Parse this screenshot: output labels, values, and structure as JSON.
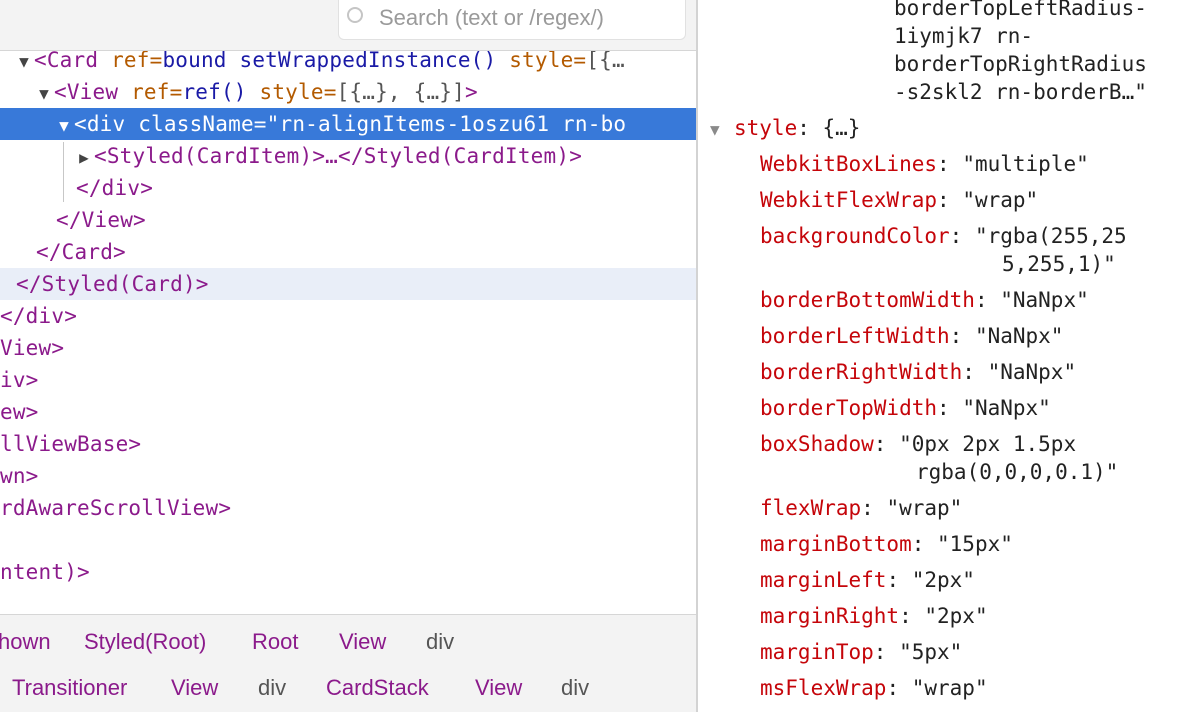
{
  "search": {
    "placeholder": "Search (text or /regex/)"
  },
  "tree": {
    "r0": {
      "open": "<",
      "name": "Card",
      "a1": "ref=",
      "v1": "bound setWrappedInstance()",
      "a2": "style=",
      "v2": "[{…"
    },
    "r1": {
      "open": "<",
      "name": "View",
      "a1": "ref=",
      "v1": "ref()",
      "a2": "style=",
      "v2": "[{…}, {…}]",
      "close": ">"
    },
    "r2": {
      "open": "<",
      "name": "div",
      "a1": "className=",
      "v1": "\"rn-alignItems-1oszu61 rn-bo"
    },
    "r3": {
      "open": "<",
      "name": "Styled(CardItem)",
      "mid": ">…</",
      "name2": "Styled(CardItem)",
      "close": ">"
    },
    "r4": {
      "text": "</div>"
    },
    "r5": {
      "text": "</View>"
    },
    "r6": {
      "text": "</Card>"
    },
    "r7": {
      "text": "</Styled(Card)>"
    },
    "r8": {
      "text": "</div>"
    },
    "r9": {
      "text": "View>"
    },
    "r10": {
      "text": "iv>"
    },
    "r11": {
      "text": "ew>"
    },
    "r12": {
      "text": "llViewBase>"
    },
    "r13": {
      "text": "wn>"
    },
    "r14": {
      "text": "rdAwareScrollView>"
    },
    "r15": {
      "text": "ntent)>"
    }
  },
  "breadcrumbs": {
    "row1": [
      "hown",
      "Styled(Root)",
      "Root",
      "View",
      "div"
    ],
    "row2": [
      "Transitioner",
      "View",
      "div",
      "CardStack",
      "View",
      "div"
    ]
  },
  "props": {
    "class_tail": [
      "borderTopLeftRadius-",
      "1iymjk7 rn-",
      "borderTopRightRadius",
      "-s2skl2 rn-borderB…\""
    ],
    "style_key": "style",
    "style_val": "{…}",
    "items": [
      {
        "key": "WebkitBoxLines",
        "value": "\"multiple\""
      },
      {
        "key": "WebkitFlexWrap",
        "value": "\"wrap\""
      },
      {
        "key": "backgroundColor",
        "value": "\"rgba(255,25",
        "value2": "5,255,1)\""
      },
      {
        "key": "borderBottomWidth",
        "value": "\"NaNpx\""
      },
      {
        "key": "borderLeftWidth",
        "value": "\"NaNpx\""
      },
      {
        "key": "borderRightWidth",
        "value": "\"NaNpx\""
      },
      {
        "key": "borderTopWidth",
        "value": "\"NaNpx\""
      },
      {
        "key": "boxShadow",
        "value": "\"0px 2px 1.5px",
        "value2": "rgba(0,0,0,0.1)\""
      },
      {
        "key": "flexWrap",
        "value": "\"wrap\""
      },
      {
        "key": "marginBottom",
        "value": "\"15px\""
      },
      {
        "key": "marginLeft",
        "value": "\"2px\""
      },
      {
        "key": "marginRight",
        "value": "\"2px\""
      },
      {
        "key": "marginTop",
        "value": "\"5px\""
      },
      {
        "key": "msFlexWrap",
        "value": "\"wrap\""
      }
    ]
  },
  "colors": {
    "selection": "#3879d9",
    "tag": "#8b1a8b",
    "prop_key": "#c5050a"
  }
}
